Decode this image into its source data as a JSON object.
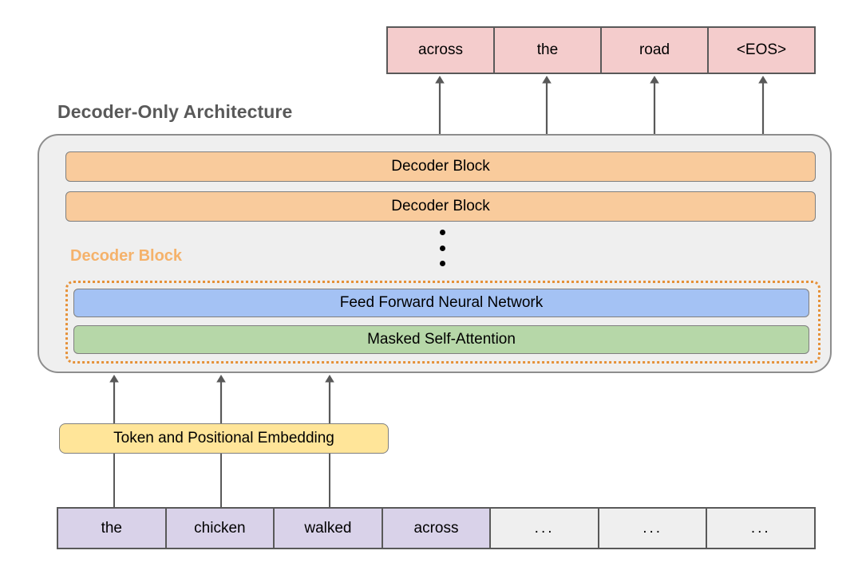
{
  "title": "Decoder-Only Architecture",
  "output_tokens": [
    {
      "label": "across"
    },
    {
      "label": "the"
    },
    {
      "label": "road"
    },
    {
      "label": "<EOS>"
    }
  ],
  "decoder_stack": [
    {
      "label": "Decoder Block"
    },
    {
      "label": "Decoder Block"
    }
  ],
  "stack_ellipsis": "vertical-three-dots",
  "expanded_block": {
    "label": "Decoder Block",
    "layers": [
      {
        "label": "Feed Forward Neural Network"
      },
      {
        "label": "Masked Self-Attention"
      }
    ]
  },
  "embedding": {
    "label": "Token and Positional Embedding"
  },
  "input_tokens": [
    {
      "label": "the",
      "filled": true
    },
    {
      "label": "chicken",
      "filled": true
    },
    {
      "label": "walked",
      "filled": true
    },
    {
      "label": "across",
      "filled": true
    },
    {
      "label": "...",
      "filled": false
    },
    {
      "label": "...",
      "filled": false
    },
    {
      "label": "...",
      "filled": false
    }
  ],
  "colors": {
    "output_token_fill": "#F4CCCC",
    "decoder_block_fill": "#F9CB9C",
    "feed_forward_fill": "#A4C2F4",
    "attention_fill": "#B6D7A8",
    "embedding_fill": "#FFE599",
    "input_token_fill": "#D9D2E9",
    "input_placeholder_fill": "#EFEFEF",
    "container_fill": "#EFEFEF",
    "dotted_border": "#E69138",
    "expanded_label_text": "#F5B26B",
    "title_text": "#595959",
    "stroke": "#595959"
  }
}
